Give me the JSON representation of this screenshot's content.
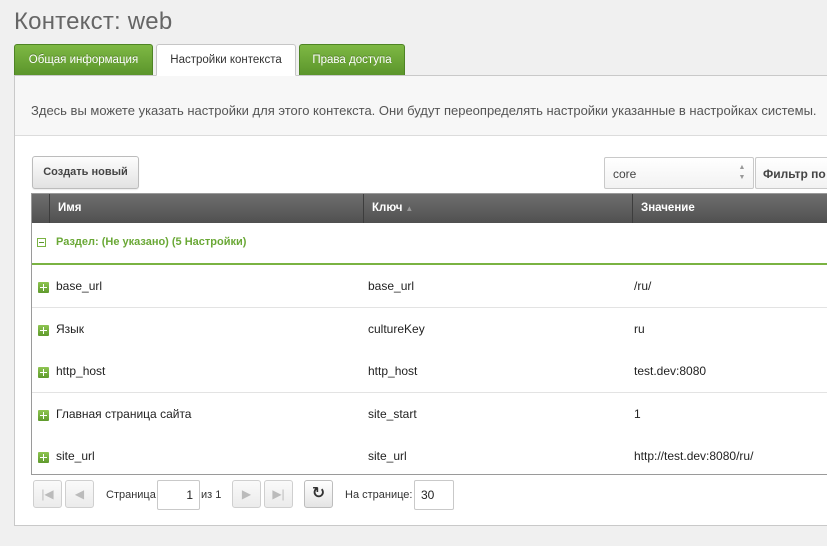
{
  "page": {
    "title": "Контекст: web"
  },
  "tabs": [
    {
      "label": "Общая информация"
    },
    {
      "label": "Настройки контекста"
    },
    {
      "label": "Права доступа"
    }
  ],
  "panel": {
    "description": "Здесь вы можете указать настройки для этого контекста. Они будут переопределять настройки указанные в настройках системы."
  },
  "toolbar": {
    "create_label": "Создать новый",
    "namespace_value": "core",
    "filter_label": "Фильтр по"
  },
  "grid": {
    "columns": [
      "Имя",
      "Ключ",
      "Значение"
    ],
    "group_label": "Раздел: (Не указано) (5 Настройки)",
    "rows": [
      {
        "name": "base_url",
        "key": "base_url",
        "value": "/ru/"
      },
      {
        "name": "Язык",
        "key": "cultureKey",
        "value": "ru"
      },
      {
        "name": "http_host",
        "key": "http_host",
        "value": "test.dev:8080"
      },
      {
        "name": "Главная страница сайта",
        "key": "site_start",
        "value": "1"
      },
      {
        "name": "site_url",
        "key": "site_url",
        "value": "http://test.dev:8080/ru/"
      }
    ]
  },
  "pager": {
    "page_label": "Страница",
    "page_value": "1",
    "of_label": "из 1",
    "per_page_label": "На странице:",
    "per_page_value": "30"
  },
  "colors": {
    "accent_green": "#6aa836",
    "header_dark": "#5a5a5a"
  }
}
